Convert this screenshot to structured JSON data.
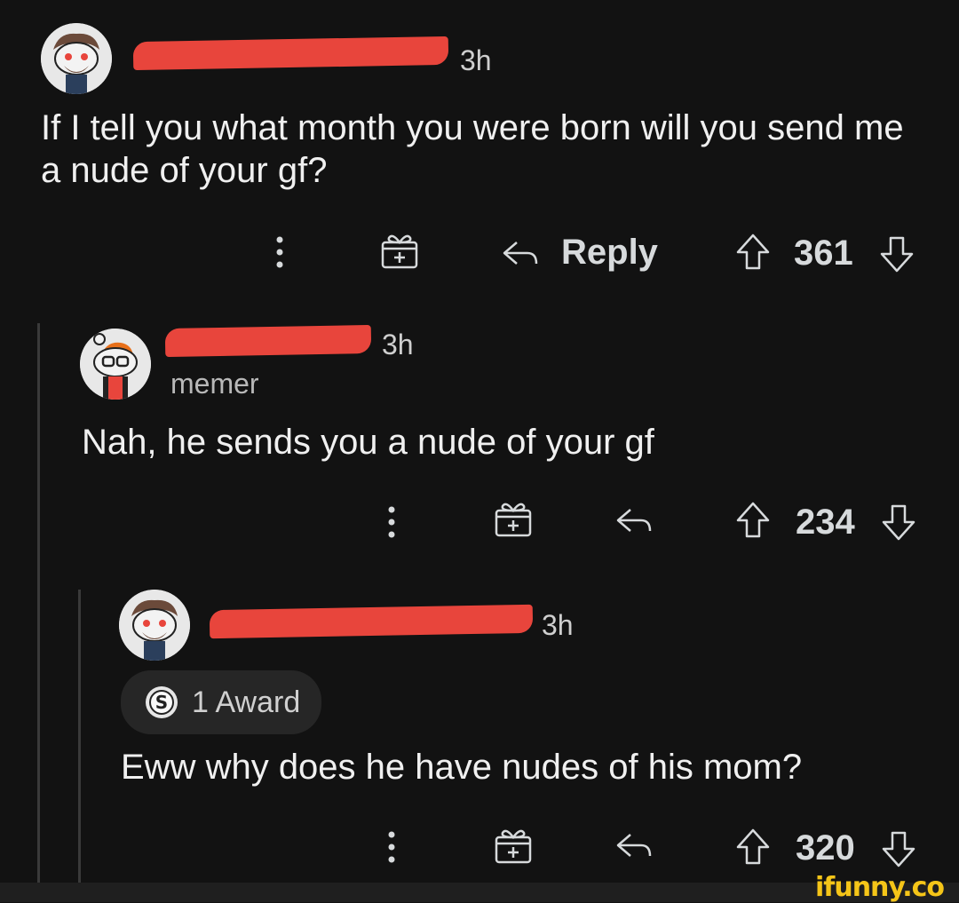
{
  "comments": [
    {
      "time": "3h",
      "body": "If I tell you what month you were born will you send me a nude of your gf?",
      "reply_label": "Reply",
      "score": "361"
    },
    {
      "time": "3h",
      "flair": "memer",
      "body": "Nah, he sends you a nude of your gf",
      "score": "234"
    },
    {
      "time": "3h",
      "award": "1 Award",
      "body": "Eww why does he have nudes of his mom?",
      "score": "320"
    }
  ],
  "watermark": "ifunny.co",
  "colors": {
    "background": "#121212",
    "redaction": "#e8453c",
    "watermark": "#f5c518"
  }
}
